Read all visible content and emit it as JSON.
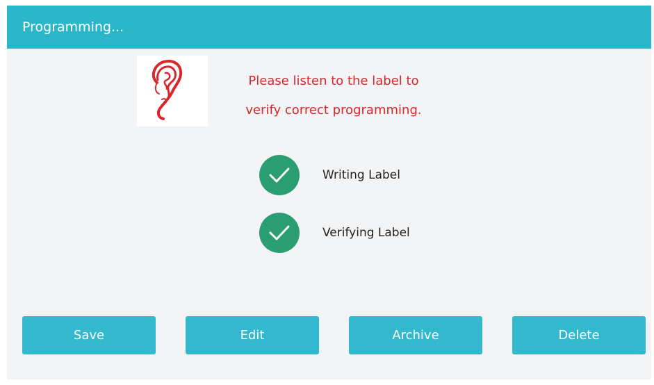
{
  "dialog": {
    "title": "Programming..."
  },
  "message": {
    "line1": "Please listen to the label to",
    "line2": "verify correct programming."
  },
  "steps": [
    {
      "label": "Writing Label",
      "status": "complete"
    },
    {
      "label": "Verifying Label",
      "status": "complete"
    }
  ],
  "buttons": {
    "save": "Save",
    "edit": "Edit",
    "archive": "Archive",
    "delete": "Delete"
  },
  "colors": {
    "title_bar": "#2bb6c9",
    "message_text": "#d8262c",
    "check": "#2a9d73",
    "button": "#33b8cd"
  },
  "icons": {
    "ear": "ear-icon",
    "check": "checkmark-icon"
  }
}
